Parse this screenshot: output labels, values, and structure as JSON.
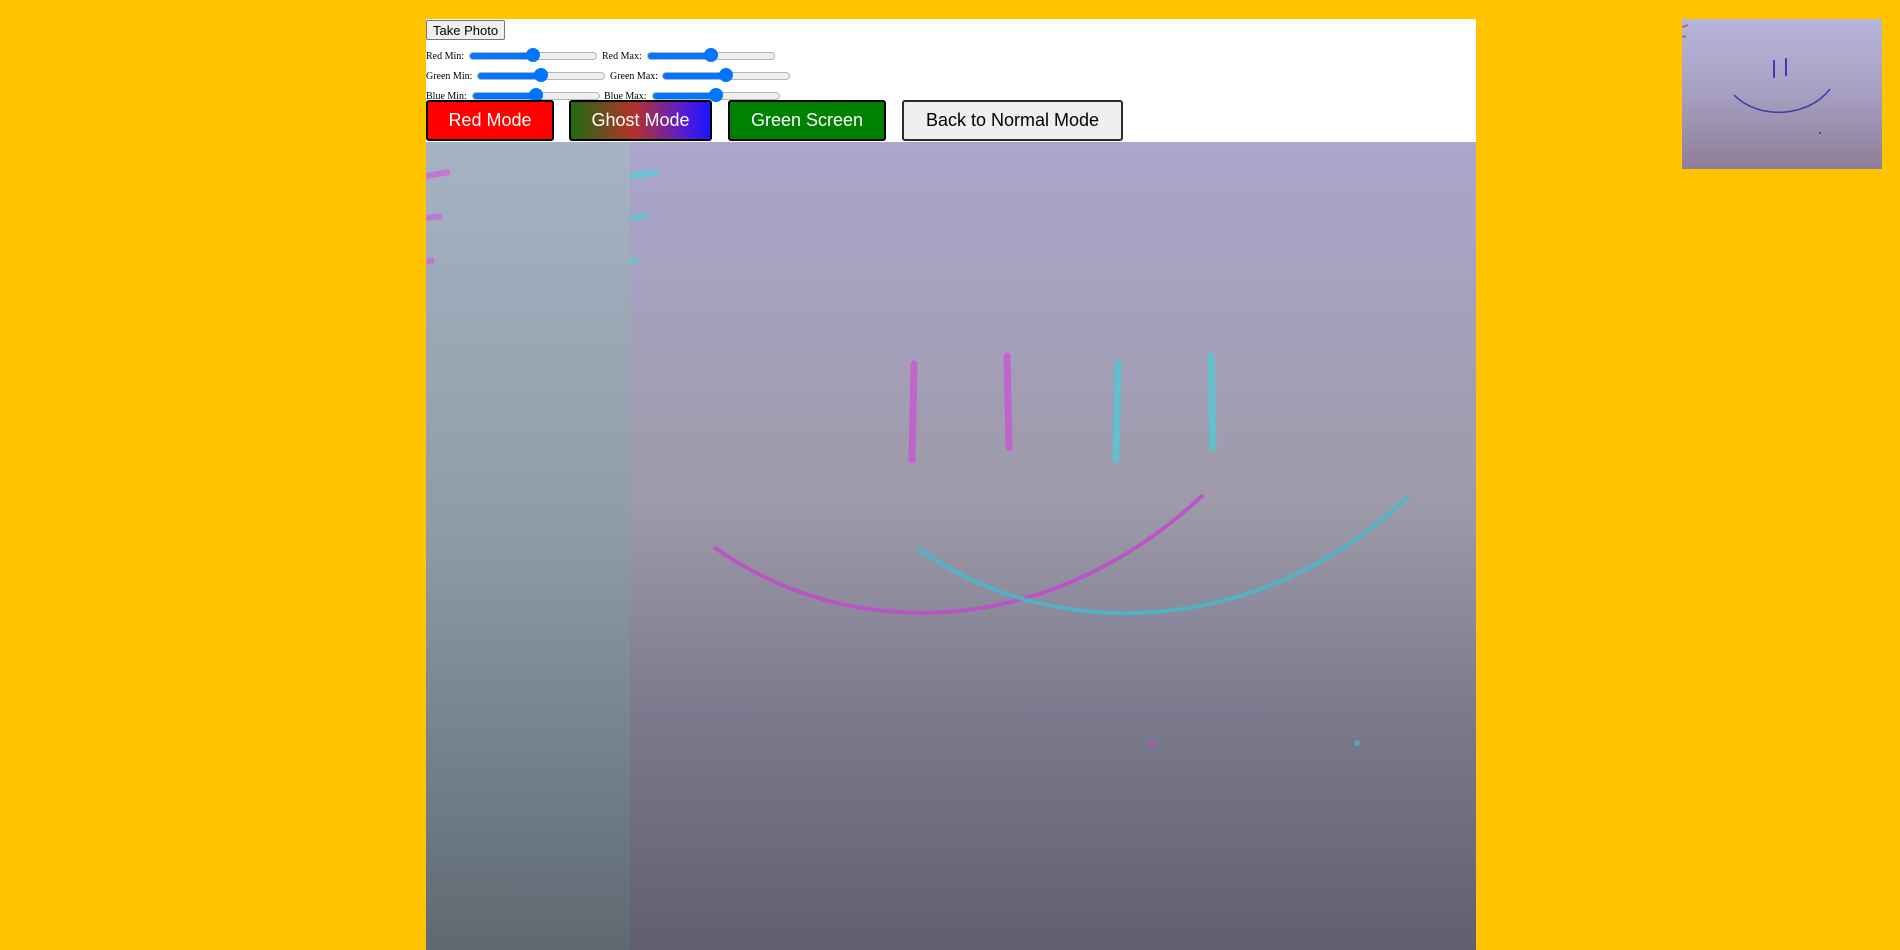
{
  "controls": {
    "take_photo_label": "Take Photo",
    "sliders": [
      {
        "id": "red-min",
        "label": "Red Min:",
        "value": 0.5
      },
      {
        "id": "red-max",
        "label": "Red Max:",
        "value": 0.5
      },
      {
        "id": "green-min",
        "label": "Green Min:",
        "value": 0.5
      },
      {
        "id": "green-max",
        "label": "Green Max:",
        "value": 0.5
      },
      {
        "id": "blue-min",
        "label": "Blue Min:",
        "value": 0.5
      },
      {
        "id": "blue-max",
        "label": "Blue Max:",
        "value": 0.5
      }
    ]
  },
  "modes": {
    "red_label": "Red Mode",
    "ghost_label": "Ghost Mode",
    "green_label": "Green Screen",
    "normal_label": "Back to Normal Mode"
  },
  "colors": {
    "page_background": "#ffc300",
    "slider_accent": "#0075ff",
    "red_mode": "#ff0000",
    "green_mode": "#008000"
  }
}
